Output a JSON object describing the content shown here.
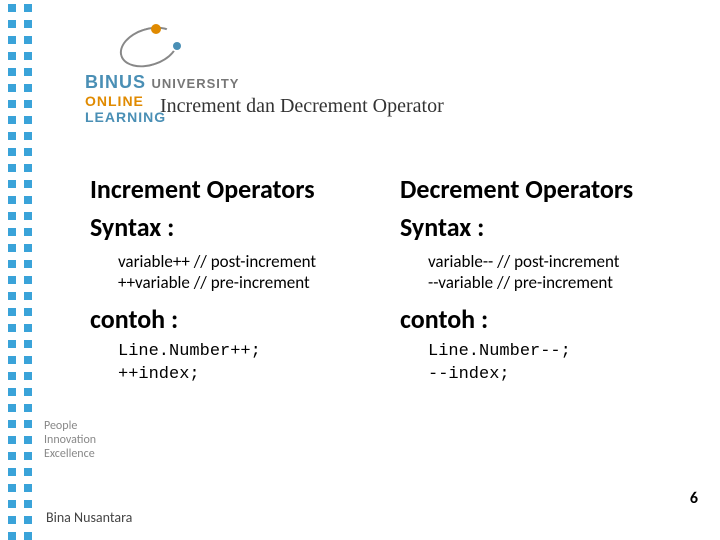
{
  "logo": {
    "name_bold": "BINUS",
    "name_rest": "UNIVERSITY",
    "line2": "ONLINE",
    "line3": "LEARNING"
  },
  "title": "Increment dan Decrement Operator",
  "left": {
    "heading": "Increment Operators",
    "syntax_label": "Syntax :",
    "syntax1": "variable++ // post-increment",
    "syntax2": "++variable // pre-increment",
    "example_label": "contoh :",
    "ex1": "Line.Number++;",
    "ex2": "++index;"
  },
  "right": {
    "heading": "Decrement Operators",
    "syntax_label": "Syntax :",
    "syntax1": "variable-- // post-increment",
    "syntax2": "--variable // pre-increment",
    "example_label": "contoh :",
    "ex1": "Line.Number--;",
    "ex2": "--index;"
  },
  "tagline": {
    "l1": "People",
    "l2": "Innovation",
    "l3": "Excellence"
  },
  "footer": "Bina Nusantara",
  "page": "6"
}
